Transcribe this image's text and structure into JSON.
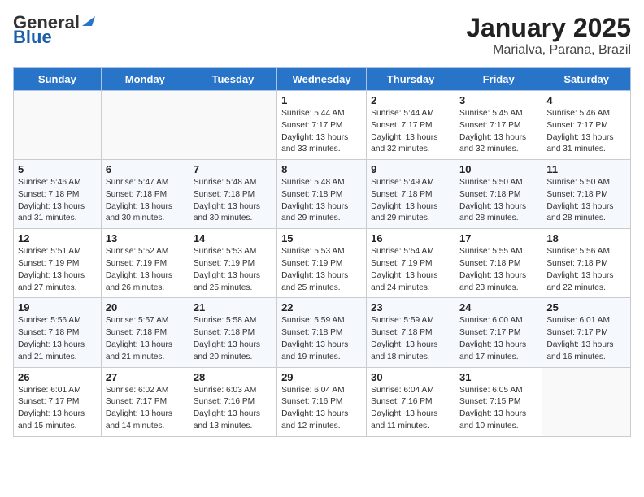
{
  "header": {
    "logo_general": "General",
    "logo_blue": "Blue",
    "month_year": "January 2025",
    "location": "Marialva, Parana, Brazil"
  },
  "weekdays": [
    "Sunday",
    "Monday",
    "Tuesday",
    "Wednesday",
    "Thursday",
    "Friday",
    "Saturday"
  ],
  "weeks": [
    [
      {
        "day": "",
        "info": ""
      },
      {
        "day": "",
        "info": ""
      },
      {
        "day": "",
        "info": ""
      },
      {
        "day": "1",
        "info": "Sunrise: 5:44 AM\nSunset: 7:17 PM\nDaylight: 13 hours\nand 33 minutes."
      },
      {
        "day": "2",
        "info": "Sunrise: 5:44 AM\nSunset: 7:17 PM\nDaylight: 13 hours\nand 32 minutes."
      },
      {
        "day": "3",
        "info": "Sunrise: 5:45 AM\nSunset: 7:17 PM\nDaylight: 13 hours\nand 32 minutes."
      },
      {
        "day": "4",
        "info": "Sunrise: 5:46 AM\nSunset: 7:17 PM\nDaylight: 13 hours\nand 31 minutes."
      }
    ],
    [
      {
        "day": "5",
        "info": "Sunrise: 5:46 AM\nSunset: 7:18 PM\nDaylight: 13 hours\nand 31 minutes."
      },
      {
        "day": "6",
        "info": "Sunrise: 5:47 AM\nSunset: 7:18 PM\nDaylight: 13 hours\nand 30 minutes."
      },
      {
        "day": "7",
        "info": "Sunrise: 5:48 AM\nSunset: 7:18 PM\nDaylight: 13 hours\nand 30 minutes."
      },
      {
        "day": "8",
        "info": "Sunrise: 5:48 AM\nSunset: 7:18 PM\nDaylight: 13 hours\nand 29 minutes."
      },
      {
        "day": "9",
        "info": "Sunrise: 5:49 AM\nSunset: 7:18 PM\nDaylight: 13 hours\nand 29 minutes."
      },
      {
        "day": "10",
        "info": "Sunrise: 5:50 AM\nSunset: 7:18 PM\nDaylight: 13 hours\nand 28 minutes."
      },
      {
        "day": "11",
        "info": "Sunrise: 5:50 AM\nSunset: 7:18 PM\nDaylight: 13 hours\nand 28 minutes."
      }
    ],
    [
      {
        "day": "12",
        "info": "Sunrise: 5:51 AM\nSunset: 7:19 PM\nDaylight: 13 hours\nand 27 minutes."
      },
      {
        "day": "13",
        "info": "Sunrise: 5:52 AM\nSunset: 7:19 PM\nDaylight: 13 hours\nand 26 minutes."
      },
      {
        "day": "14",
        "info": "Sunrise: 5:53 AM\nSunset: 7:19 PM\nDaylight: 13 hours\nand 25 minutes."
      },
      {
        "day": "15",
        "info": "Sunrise: 5:53 AM\nSunset: 7:19 PM\nDaylight: 13 hours\nand 25 minutes."
      },
      {
        "day": "16",
        "info": "Sunrise: 5:54 AM\nSunset: 7:19 PM\nDaylight: 13 hours\nand 24 minutes."
      },
      {
        "day": "17",
        "info": "Sunrise: 5:55 AM\nSunset: 7:18 PM\nDaylight: 13 hours\nand 23 minutes."
      },
      {
        "day": "18",
        "info": "Sunrise: 5:56 AM\nSunset: 7:18 PM\nDaylight: 13 hours\nand 22 minutes."
      }
    ],
    [
      {
        "day": "19",
        "info": "Sunrise: 5:56 AM\nSunset: 7:18 PM\nDaylight: 13 hours\nand 21 minutes."
      },
      {
        "day": "20",
        "info": "Sunrise: 5:57 AM\nSunset: 7:18 PM\nDaylight: 13 hours\nand 21 minutes."
      },
      {
        "day": "21",
        "info": "Sunrise: 5:58 AM\nSunset: 7:18 PM\nDaylight: 13 hours\nand 20 minutes."
      },
      {
        "day": "22",
        "info": "Sunrise: 5:59 AM\nSunset: 7:18 PM\nDaylight: 13 hours\nand 19 minutes."
      },
      {
        "day": "23",
        "info": "Sunrise: 5:59 AM\nSunset: 7:18 PM\nDaylight: 13 hours\nand 18 minutes."
      },
      {
        "day": "24",
        "info": "Sunrise: 6:00 AM\nSunset: 7:17 PM\nDaylight: 13 hours\nand 17 minutes."
      },
      {
        "day": "25",
        "info": "Sunrise: 6:01 AM\nSunset: 7:17 PM\nDaylight: 13 hours\nand 16 minutes."
      }
    ],
    [
      {
        "day": "26",
        "info": "Sunrise: 6:01 AM\nSunset: 7:17 PM\nDaylight: 13 hours\nand 15 minutes."
      },
      {
        "day": "27",
        "info": "Sunrise: 6:02 AM\nSunset: 7:17 PM\nDaylight: 13 hours\nand 14 minutes."
      },
      {
        "day": "28",
        "info": "Sunrise: 6:03 AM\nSunset: 7:16 PM\nDaylight: 13 hours\nand 13 minutes."
      },
      {
        "day": "29",
        "info": "Sunrise: 6:04 AM\nSunset: 7:16 PM\nDaylight: 13 hours\nand 12 minutes."
      },
      {
        "day": "30",
        "info": "Sunrise: 6:04 AM\nSunset: 7:16 PM\nDaylight: 13 hours\nand 11 minutes."
      },
      {
        "day": "31",
        "info": "Sunrise: 6:05 AM\nSunset: 7:15 PM\nDaylight: 13 hours\nand 10 minutes."
      },
      {
        "day": "",
        "info": ""
      }
    ]
  ]
}
